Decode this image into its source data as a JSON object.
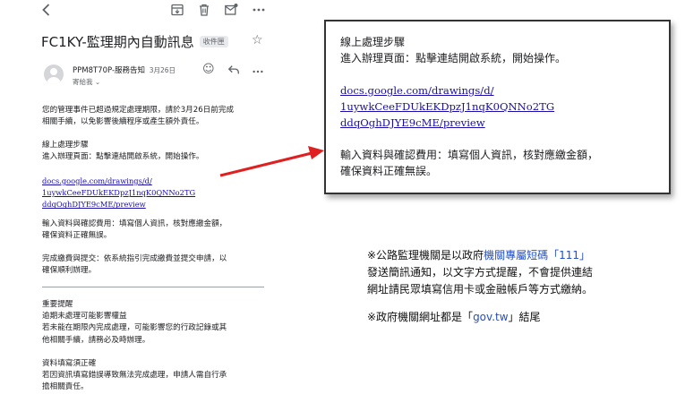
{
  "toolbar": {
    "back_icon": "chevron-left-icon",
    "archive_icon": "archive-icon",
    "delete_icon": "trash-icon",
    "mark_unread_icon": "mail-icon",
    "more_icon": "more-vert-icon"
  },
  "email": {
    "subject": "FC1KY-監理期內自動訊息",
    "label": "收件匣",
    "sender": "PPM8T70P-服務告知",
    "date": "3月26日",
    "recipient": "寄給我 ⌄",
    "body": {
      "p1": [
        "您的管理事件已超過規定處理期限，請於3月26日前完成",
        "相關手續，以免影響後續程序或產生額外責任。"
      ],
      "steps_title": "線上處理步驟",
      "step1": "進入辦理頁面：點擊連結開啟系統，開始操作。",
      "link": [
        "docs.google.com/drawings/d/",
        "1uywkCeeFDUkEKDpzJ1nqK0QNNo2TG",
        "ddqOghDJYE9cME/preview"
      ],
      "step2": [
        "輸入資料與確認費用：填寫個人資訊，核對應繳金額，",
        "確保資料正確無誤。"
      ],
      "step3": [
        "完成繳費與提交：依系統指引完成繳費並提交申請，以",
        "確保順利辦理。"
      ],
      "reminder_title": "重要提醒",
      "reminder1": "逾期未處理可能影響權益",
      "reminder2": [
        "若未能在期限內完成處理，可能影響您的行政記錄或其",
        "他相關手續，請務必及時辦理。"
      ],
      "reminder3_title": "資料填寫須正確",
      "reminder3": [
        "若因資訊填寫錯誤導致無法完成處理，申請人需自行承",
        "擔相關責任。"
      ]
    }
  },
  "callout": {
    "title": "線上處理步驟",
    "step1": "進入辦理頁面：點擊連結開啟系統，開始操作。",
    "link": [
      "docs.google.com/drawings/d/",
      "1uywkCeeFDUkEKDpzJ1nqK0QNNo2TG",
      "ddqOghDJYE9cME/preview"
    ],
    "step2": [
      "輸入資料與確認費用：填寫個人資訊，核對應繳金額，",
      "確保資料正確無誤。"
    ]
  },
  "notes": {
    "note1_a": "※公路監理機關是以政府",
    "note1_hl": "機關專屬短碼「111」",
    "note1_b": "發送簡訊通知，以文字方式提醒，不會提供連結",
    "note1_c": "網址請民眾填寫信用卡或金融帳戶等方式繳納。",
    "note2_a": "※政府機關網址都是「",
    "note2_hl": "gov.tw",
    "note2_b": "」結尾"
  },
  "colors": {
    "arrow": "#e02020",
    "link": "#1a0dab",
    "highlight": "#1f4fd0"
  }
}
